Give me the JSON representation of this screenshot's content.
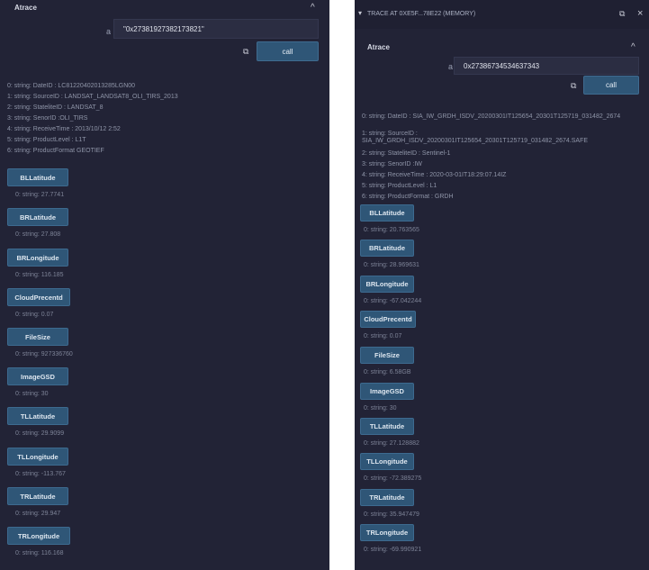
{
  "left": {
    "section_title": "Atrace",
    "chevron": "^",
    "input_label": "a",
    "input_value": "\"0x27381927382173821\"",
    "copy_icon": "copy-icon",
    "call_label": "call",
    "output_lines": [
      "0: string: DateID : LC81220402013285LGN00",
      "1: string: SourceID : LANDSAT_LANDSAT8_OLI_TIRS_2013",
      "2: string: StateliteID : LANDSAT_8",
      "3: string: SenorID :OLI_TIRS",
      "4: string: ReceiveTime : 2013/10/12 2:52",
      "5: string: ProductLevel : L1T",
      "6: string: ProductFormat GEOTIEF"
    ],
    "functions": [
      {
        "label": "BLLatitude",
        "result": "0: string: 27.7741"
      },
      {
        "label": "BRLatitude",
        "result": "0: string: 27.808"
      },
      {
        "label": "BRLongitude",
        "result": "0: string: 116.185"
      },
      {
        "label": "CloudPrecentd",
        "result": "0: string: 0.07"
      },
      {
        "label": "FileSize",
        "result": "0: string: 927336760"
      },
      {
        "label": "ImageGSD",
        "result": "0: string: 30"
      },
      {
        "label": "TLLatitude",
        "result": "0: string: 29.9099"
      },
      {
        "label": "TLLongitude",
        "result": "0: string: -113.767"
      },
      {
        "label": "TRLatitude",
        "result": "0: string: 29.947"
      },
      {
        "label": "TRLongitude",
        "result": "0: string: 116.168"
      }
    ]
  },
  "right": {
    "trace_header": "TRACE AT 0XE5F...78E22 (MEMORY)",
    "header_chevron": "▾",
    "close": "×",
    "section_title": "Atrace",
    "chevron": "^",
    "input_label": "a",
    "input_value": "0x27386734534637343",
    "call_label": "call",
    "output_lines": [
      "0: string: DateID : SIA_IW_GRDH_ISDV_20200301IT125654_20301T125719_031482_2674",
      "1: string: SourceID : SIA_IW_GRDH_ISDV_20200301IT125654_20301T125719_031482_2674.SAFE",
      "2: string: StateliteID : Sentinel-1",
      "3: string: SenorID :IW",
      "4: string: ReceiveTime : 2020-03-01IT18:29:07.14IZ",
      "5: string: ProductLevel : L1",
      "6: string: ProductFormat : GRDH"
    ],
    "functions": [
      {
        "label": "BLLatitude",
        "result": "0: string: 20.763565"
      },
      {
        "label": "BRLatitude",
        "result": "0: string: 28.969631"
      },
      {
        "label": "BRLongitude",
        "result": "0: string: -67.042244"
      },
      {
        "label": "CloudPrecentd",
        "result": "0: string: 0.07"
      },
      {
        "label": "FileSize",
        "result": "0: string: 6.58GB"
      },
      {
        "label": "ImageGSD",
        "result": "0: string: 30"
      },
      {
        "label": "TLLatitude",
        "result": "0: string: 27.128882"
      },
      {
        "label": "TLLongitude",
        "result": "0: string: -72.389275"
      },
      {
        "label": "TRLatitude",
        "result": "0: string: 35.947479"
      },
      {
        "label": "TRLongitude",
        "result": "0: string: -69.990921"
      }
    ]
  }
}
